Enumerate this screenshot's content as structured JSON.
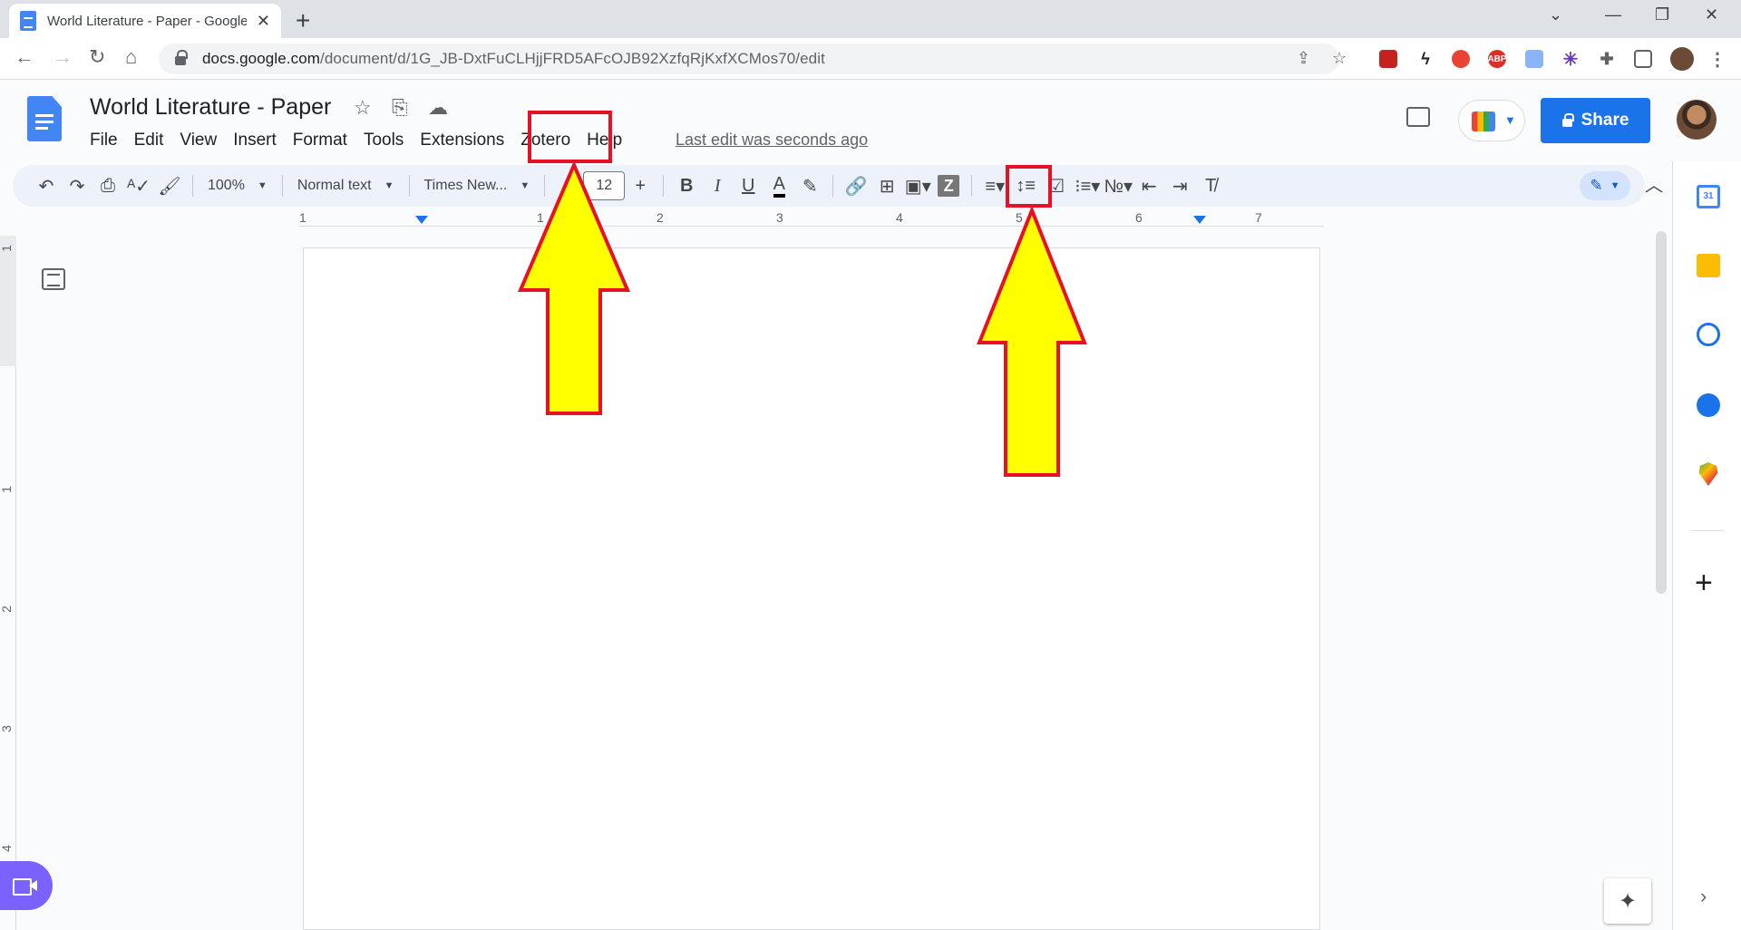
{
  "browser": {
    "tab_title": "World Literature - Paper - Google",
    "url_host": "docs.google.com",
    "url_path": "/document/d/1G_JB-DxtFuCLHjjFRD5AFcOJB92XzfqRjKxfXCMos70/edit",
    "extensions": [
      "book-extension",
      "lightning-extension",
      "adblock-stop",
      "adblock-plus",
      "docs-extension",
      "snowflake-extension",
      "puzzle-icon"
    ],
    "ext_labels": {
      "abp": "ABP"
    }
  },
  "doc": {
    "title": "World Literature - Paper",
    "menus": [
      "File",
      "Edit",
      "View",
      "Insert",
      "Format",
      "Tools",
      "Extensions",
      "Zotero",
      "Help"
    ],
    "last_edit": "Last edit was seconds ago",
    "share_label": "Share"
  },
  "toolbar": {
    "zoom": "100%",
    "style": "Normal text",
    "font": "Times New...",
    "font_size": "12",
    "bold": "B",
    "italic": "I",
    "underline": "U",
    "text_color": "A",
    "zotero_glyph": "Z"
  },
  "ruler": {
    "h_labels": [
      "1",
      "1",
      "2",
      "3",
      "4",
      "5",
      "6",
      "7"
    ],
    "v_labels": [
      "1",
      "1",
      "2",
      "3",
      "4"
    ]
  },
  "side_panel": {
    "calendar_day": "31"
  },
  "colors": {
    "accent": "#1a73e8",
    "annotation_border": "#e81123",
    "annotation_fill": "#ffff00"
  }
}
